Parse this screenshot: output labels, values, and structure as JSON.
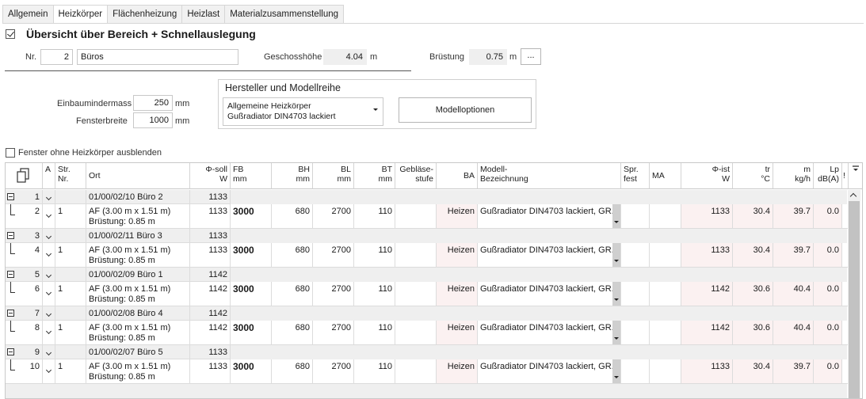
{
  "tabs": [
    "Allgemein",
    "Heizkörper",
    "Flächenheizung",
    "Heizlast",
    "Materialzusammenstellung"
  ],
  "active_tab": 1,
  "overview": {
    "title": "Übersicht über Bereich + Schnellauslegung",
    "checked": true,
    "nr_label": "Nr.",
    "nr_value": "2",
    "name_value": "Büros",
    "geschoss_label": "Geschosshöhe",
    "geschoss_value": "4.04",
    "geschoss_unit": "m",
    "bruestung_label": "Brüstung",
    "bruestung_value": "0.75",
    "bruestung_unit": "m",
    "more_button": "..."
  },
  "dims": {
    "einbau_label": "Einbaumindermass",
    "einbau_value": "250",
    "einbau_unit": "mm",
    "fenster_label": "Fensterbreite",
    "fenster_value": "1000",
    "fenster_unit": "mm"
  },
  "manufacturer": {
    "title": "Hersteller und Modellreihe",
    "line1": "Allgemeine Heizkörper",
    "line2": "Gußradiator DIN4703 lackiert",
    "options_button": "Modelloptionen"
  },
  "hide_windows": {
    "label": "Fenster ohne Heizkörper ausblenden",
    "checked": false
  },
  "grid": {
    "headers": {
      "a": "A",
      "str1": "Str.",
      "str2": "Nr.",
      "ort": "Ort",
      "phisoll1": "Φ-soll",
      "phisoll2": "W",
      "fb1": "FB",
      "fb2": "mm",
      "bh1": "BH",
      "bh2": "mm",
      "bl1": "BL",
      "bl2": "mm",
      "bt1": "BT",
      "bt2": "mm",
      "geb1": "Gebläse-",
      "geb2": "stufe",
      "ba": "BA",
      "modell1": "Modell-",
      "modell2": "Bezeichnung",
      "spr1": "Spr.",
      "spr2": "fest",
      "ma": "MA",
      "phiist1": "Φ-ist",
      "phiist2": "W",
      "tr1": "tr",
      "tr2": "°C",
      "m1": "m",
      "m2": "kg/h",
      "lp1": "Lp",
      "lp2": "dB(A)",
      "excl": "!"
    },
    "rows": [
      {
        "type": "group",
        "nr": "1",
        "ort": "01/00/02/10 Büro 2",
        "phisoll": "1133"
      },
      {
        "type": "detail",
        "nr": "2",
        "str": "1",
        "ort1": "AF (3.00 m x 1.51 m)",
        "ort2": "Brüstung: 0.85 m",
        "phisoll": "1133",
        "fb": "3000",
        "bh": "680",
        "bl": "2700",
        "bt": "110",
        "ba": "Heizen",
        "modell": "Gußradiator DIN4703 lackiert, GR...",
        "phiist": "1133",
        "tr": "30.4",
        "m": "39.7",
        "lp": "0.0"
      },
      {
        "type": "group",
        "nr": "3",
        "ort": "01/00/02/11 Büro 3",
        "phisoll": "1133"
      },
      {
        "type": "detail",
        "nr": "4",
        "str": "1",
        "ort1": "AF (3.00 m x 1.51 m)",
        "ort2": "Brüstung: 0.85 m",
        "phisoll": "1133",
        "fb": "3000",
        "bh": "680",
        "bl": "2700",
        "bt": "110",
        "ba": "Heizen",
        "modell": "Gußradiator DIN4703 lackiert, GR...",
        "phiist": "1133",
        "tr": "30.4",
        "m": "39.7",
        "lp": "0.0"
      },
      {
        "type": "group",
        "nr": "5",
        "ort": "01/00/02/09 Büro 1",
        "phisoll": "1142"
      },
      {
        "type": "detail",
        "nr": "6",
        "str": "1",
        "ort1": "AF (3.00 m x 1.51 m)",
        "ort2": "Brüstung: 0.85 m",
        "phisoll": "1142",
        "fb": "3000",
        "bh": "680",
        "bl": "2700",
        "bt": "110",
        "ba": "Heizen",
        "modell": "Gußradiator DIN4703 lackiert, GR...",
        "phiist": "1142",
        "tr": "30.6",
        "m": "40.4",
        "lp": "0.0"
      },
      {
        "type": "group",
        "nr": "7",
        "ort": "01/00/02/08 Büro 4",
        "phisoll": "1142"
      },
      {
        "type": "detail",
        "nr": "8",
        "str": "1",
        "ort1": "AF (3.00 m x 1.51 m)",
        "ort2": "Brüstung: 0.85 m",
        "phisoll": "1142",
        "fb": "3000",
        "bh": "680",
        "bl": "2700",
        "bt": "110",
        "ba": "Heizen",
        "modell": "Gußradiator DIN4703 lackiert, GR...",
        "phiist": "1142",
        "tr": "30.6",
        "m": "40.4",
        "lp": "0.0"
      },
      {
        "type": "group",
        "nr": "9",
        "ort": "01/00/02/07 Büro 5",
        "phisoll": "1133"
      },
      {
        "type": "detail",
        "nr": "10",
        "str": "1",
        "ort1": "AF (3.00 m x 1.51 m)",
        "ort2": "Brüstung: 0.85 m",
        "phisoll": "1133",
        "fb": "3000",
        "bh": "680",
        "bl": "2700",
        "bt": "110",
        "ba": "Heizen",
        "modell": "Gußradiator DIN4703 lackiert, GR...",
        "phiist": "1133",
        "tr": "30.4",
        "m": "39.7",
        "lp": "0.0"
      }
    ]
  },
  "icons": {
    "copy": "copy-icon",
    "filter": "filter-icon",
    "expand": "collapse-icon",
    "chevron": "chevron-down-icon"
  }
}
